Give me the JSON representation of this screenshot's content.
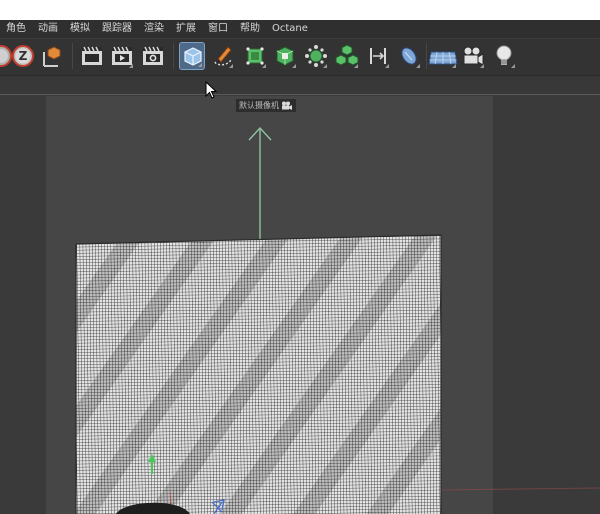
{
  "menu": [
    "角色",
    "动画",
    "模拟",
    "跟踪器",
    "渲染",
    "扩展",
    "窗口",
    "帮助",
    "Octane"
  ],
  "toolbar": {
    "axis_z_label": "Z"
  },
  "viewport": {
    "camera_label": "默认摄像机"
  },
  "colors": {
    "background": "#3b3b3b",
    "safe_frame": "#464646",
    "accent_active": "#4e6a88",
    "axis_y": "#8fc0a0",
    "mesh_fill": "#e4e4e4"
  },
  "icons": [
    "axis-x-icon",
    "axis-z-icon",
    "coordinate-system-icon",
    "render-view-icon",
    "render-to-picture-viewer-icon",
    "render-settings-icon",
    "cube-icon",
    "pen-icon",
    "subdivision-icon",
    "extrude-icon",
    "array-icon",
    "mograph-cloner-icon",
    "deformer-icon",
    "field-icon",
    "floor-icon",
    "camera-icon",
    "light-icon"
  ]
}
